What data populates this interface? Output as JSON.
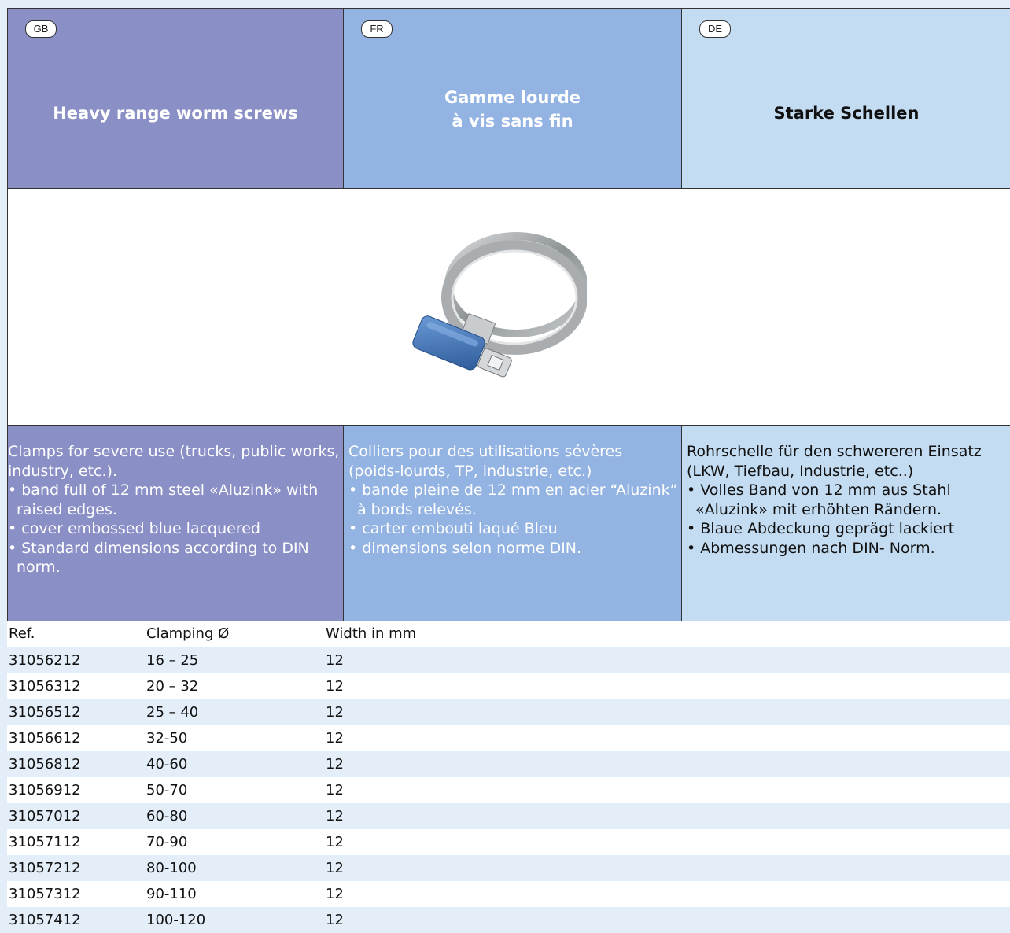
{
  "columns": {
    "gb": {
      "badge": "GB",
      "title_lines": [
        "Heavy range worm screws"
      ],
      "intro": "Clamps for severe use (trucks, public works, industry, etc.).",
      "bullets": [
        "band full of 12 mm steel «Aluzink» with raised edges.",
        "cover embossed blue lacquered",
        "Standard dimensions according to DIN norm."
      ]
    },
    "fr": {
      "badge": "FR",
      "title_lines": [
        "Gamme lourde",
        "à vis sans fin"
      ],
      "intro": "Colliers pour des utilisations sévères (poids-lourds, TP, industrie, etc.)",
      "bullets": [
        "bande pleine de 12 mm en acier “Aluzink” à bords relevés.",
        "carter embouti laqué Bleu",
        "dimensions selon norme DIN."
      ]
    },
    "de": {
      "badge": "DE",
      "title_lines": [
        "Starke Schellen"
      ],
      "intro": "Rohrschelle für den schwereren Einsatz (LKW, Tiefbau, Industrie, etc..)",
      "bullets": [
        "Volles Band von 12 mm aus Stahl «Aluzink» mit erhöhten Rändern.",
        "Blaue Abdeckung geprägt lackiert",
        "Abmessungen nach DIN- Norm."
      ]
    }
  },
  "colors": {
    "gb": "#8a8fc6",
    "fr": "#93b3e2",
    "de": "#c3dcf2",
    "clamp_cover": "#3f74b8"
  },
  "table": {
    "headers": [
      "Ref.",
      "Clamping Ø",
      "Width in mm"
    ],
    "rows": [
      [
        "31056212",
        "16 – 25",
        "12"
      ],
      [
        "31056312",
        "20 – 32",
        "12"
      ],
      [
        "31056512",
        "25 – 40",
        "12"
      ],
      [
        "31056612",
        "32-50",
        "12"
      ],
      [
        "31056812",
        "40-60",
        "12"
      ],
      [
        "31056912",
        "50-70",
        "12"
      ],
      [
        "31057012",
        "60-80",
        "12"
      ],
      [
        "31057112",
        "70-90",
        "12"
      ],
      [
        "31057212",
        "80-100",
        "12"
      ],
      [
        "31057312",
        "90-110",
        "12"
      ],
      [
        "31057412",
        "100-120",
        "12"
      ]
    ]
  }
}
